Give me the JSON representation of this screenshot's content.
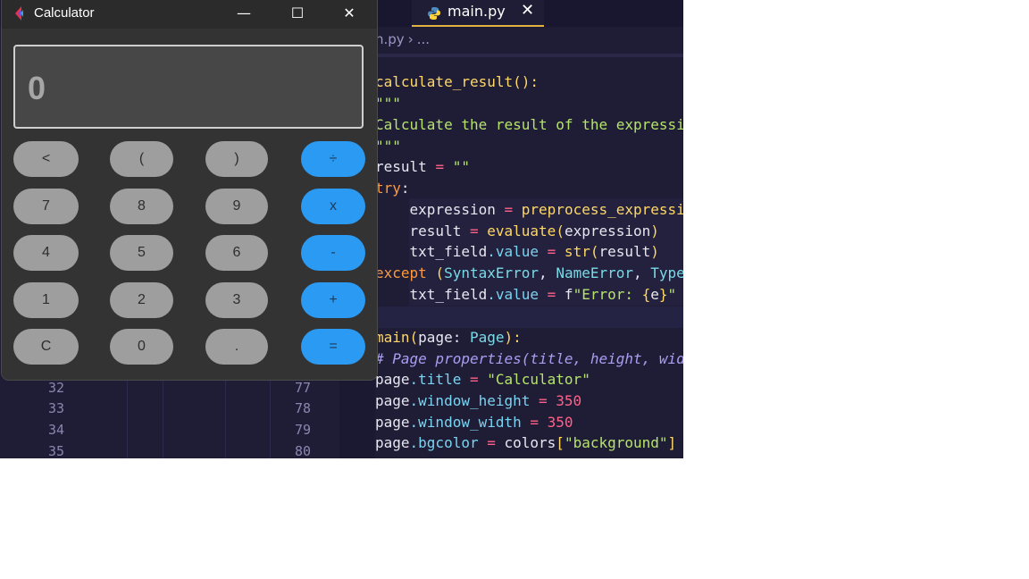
{
  "editor": {
    "tab": {
      "label": "main.py",
      "close_glyph": "✕",
      "icon": "python-icon"
    },
    "breadcrumb": {
      "file": "n.py",
      "separator": "›",
      "rest": "..."
    },
    "code_lines": [
      [
        [
          "fn",
          "calculate_result"
        ],
        [
          "brk",
          "():"
        ]
      ],
      [
        [
          "str",
          "\"\"\""
        ]
      ],
      [
        [
          "str",
          "Calculate the result of the expressi"
        ]
      ],
      [
        [
          "str",
          "\"\"\""
        ]
      ],
      [
        [
          "plain",
          "result "
        ],
        [
          "op",
          "="
        ],
        [
          "str",
          " \"\""
        ]
      ],
      [
        [
          "kw",
          "try"
        ],
        [
          "plain",
          ":"
        ]
      ],
      [
        [
          "plain",
          "    expression "
        ],
        [
          "op",
          "="
        ],
        [
          "fn",
          " preprocess_expressi"
        ]
      ],
      [
        [
          "plain",
          "    result "
        ],
        [
          "op",
          "="
        ],
        [
          "fn",
          " evaluate"
        ],
        [
          "brk",
          "("
        ],
        [
          "plain",
          "expression"
        ],
        [
          "brk",
          ")"
        ]
      ],
      [
        [
          "plain",
          "    txt_field"
        ],
        [
          "prop",
          ".value"
        ],
        [
          "op",
          " ="
        ],
        [
          "fn",
          " str"
        ],
        [
          "brk",
          "("
        ],
        [
          "plain",
          "result"
        ],
        [
          "brk",
          ")"
        ]
      ],
      [
        [
          "kw",
          "except "
        ],
        [
          "brk",
          "("
        ],
        [
          "cls",
          "SyntaxError"
        ],
        [
          "plain",
          ", "
        ],
        [
          "cls",
          "NameError"
        ],
        [
          "plain",
          ", "
        ],
        [
          "cls",
          "Type"
        ]
      ],
      [
        [
          "plain",
          "    txt_field"
        ],
        [
          "prop",
          ".value"
        ],
        [
          "op",
          " ="
        ],
        [
          "plain",
          " f"
        ],
        [
          "str",
          "\"Error: "
        ],
        [
          "brk",
          "{"
        ],
        [
          "plain",
          "e"
        ],
        [
          "brk",
          "}"
        ],
        [
          "str",
          "\""
        ]
      ],
      [
        [
          "plain",
          ""
        ]
      ],
      [
        [
          "fn",
          "main"
        ],
        [
          "brk",
          "("
        ],
        [
          "plain",
          "page: "
        ],
        [
          "cls",
          "Page"
        ],
        [
          "brk",
          "):"
        ]
      ],
      [
        [
          "cmt",
          "# Page properties(title, height, wid"
        ]
      ],
      [
        [
          "plain",
          "page"
        ],
        [
          "prop",
          ".title"
        ],
        [
          "op",
          " ="
        ],
        [
          "str",
          " \"Calculator\""
        ]
      ],
      [
        [
          "plain",
          "page"
        ],
        [
          "prop",
          ".window_height"
        ],
        [
          "op",
          " ="
        ],
        [
          "num",
          " 350"
        ]
      ],
      [
        [
          "plain",
          "page"
        ],
        [
          "prop",
          ".window_width"
        ],
        [
          "op",
          " ="
        ],
        [
          "num",
          " 350"
        ]
      ],
      [
        [
          "plain",
          "page"
        ],
        [
          "prop",
          ".bgcolor"
        ],
        [
          "op",
          " ="
        ],
        [
          "plain",
          " colors"
        ],
        [
          "brk",
          "["
        ],
        [
          "str",
          "\"background\""
        ],
        [
          "brk",
          "]"
        ]
      ]
    ],
    "gutter_left": [
      "32",
      "33",
      "34",
      "35"
    ],
    "gutter_right": [
      "77",
      "78",
      "79",
      "80"
    ]
  },
  "calculator": {
    "title": "Calculator",
    "window_controls": {
      "minimize": "—",
      "maximize": "☐",
      "close": "✕"
    },
    "display_value": "0",
    "keys": [
      [
        "<",
        "(",
        ")",
        "÷"
      ],
      [
        "7",
        "8",
        "9",
        "x"
      ],
      [
        "4",
        "5",
        "6",
        "-"
      ],
      [
        "1",
        "2",
        "3",
        "+"
      ],
      [
        "C",
        "0",
        ".",
        "="
      ]
    ],
    "colors": {
      "key_gray": "#9e9e9e",
      "key_blue": "#2b9af3",
      "background": "#333333",
      "display": "#474747"
    }
  }
}
